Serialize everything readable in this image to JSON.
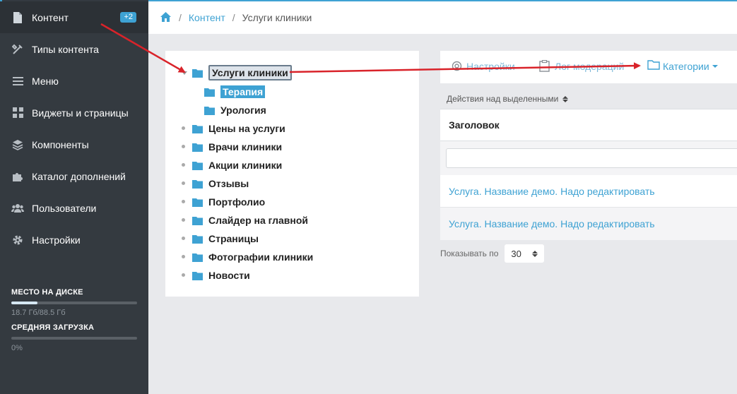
{
  "sidebar": {
    "items": [
      {
        "label": "Контент",
        "icon": "document-icon",
        "badge": "+2"
      },
      {
        "label": "Типы контента",
        "icon": "tools-icon"
      },
      {
        "label": "Меню",
        "icon": "menu-icon"
      },
      {
        "label": "Виджеты и страницы",
        "icon": "grid-icon"
      },
      {
        "label": "Компоненты",
        "icon": "layers-icon"
      },
      {
        "label": "Каталог дополнений",
        "icon": "puzzle-icon"
      },
      {
        "label": "Пользователи",
        "icon": "users-icon"
      },
      {
        "label": "Настройки",
        "icon": "gear-icon"
      }
    ],
    "disk": {
      "title": "МЕСТО НА ДИСКЕ",
      "value": "18.7 Гб/88.5 Гб",
      "fill_fraction": 0.21
    },
    "load": {
      "title": "СРЕДНЯЯ ЗАГРУЗКА",
      "value": "0%",
      "fill_fraction": 0.0
    }
  },
  "breadcrumb": {
    "home_icon": "home-icon",
    "link": "Контент",
    "current": "Услуги клиники"
  },
  "tree": {
    "root": "Услуги клиники",
    "children": [
      "Терапия",
      "Урология"
    ],
    "others": [
      "Цены на услуги",
      "Врачи клиники",
      "Акции клиники",
      "Отзывы",
      "Портфолио",
      "Слайдер на главной",
      "Страницы",
      "Фотографии клиники",
      "Новости"
    ]
  },
  "toolbar": {
    "settings": "Настройки",
    "moderation_log": "Лог модераций",
    "categories": "Категории"
  },
  "table": {
    "bulk_actions": "Действия над выделенными",
    "column_title": "Заголовок",
    "rows": [
      "Услуга. Название демо. Надо редактировать",
      "Услуга. Название демо. Надо редактировать"
    ],
    "per_page_label": "Показывать по",
    "per_page_value": "30"
  },
  "colors": {
    "sidebar_bg": "#343a40",
    "accent": "#3ea2d3",
    "arrow": "#d9232a"
  }
}
